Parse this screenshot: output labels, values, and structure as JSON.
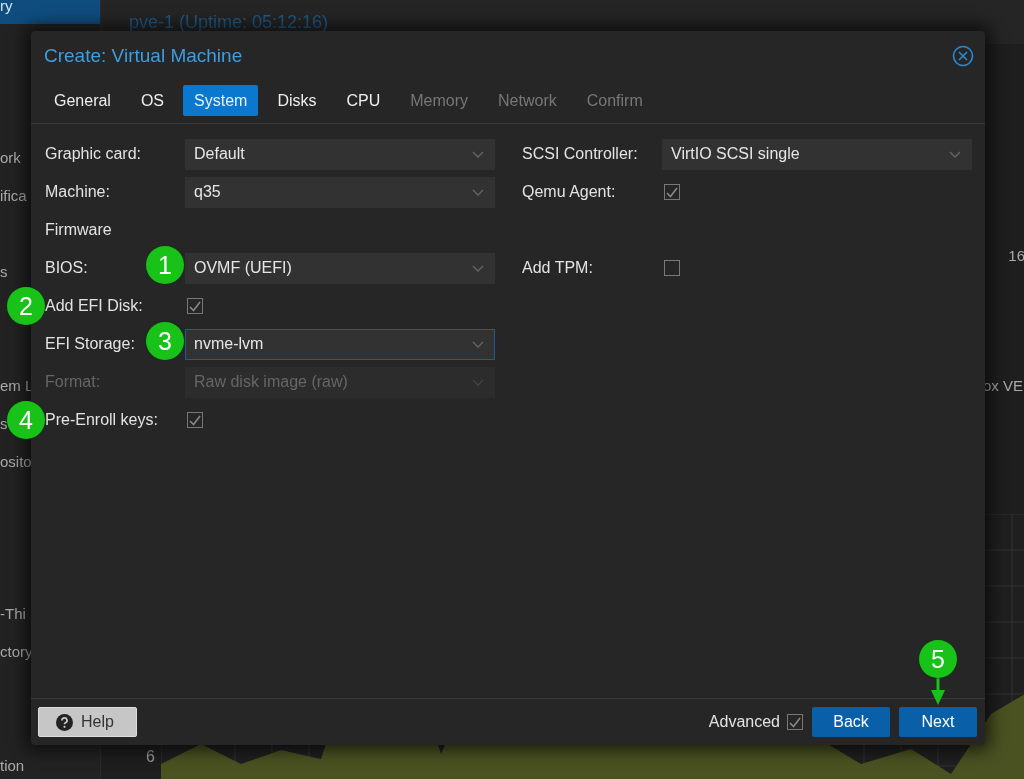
{
  "background": {
    "sidebar": [
      {
        "label": "ry",
        "selected": true
      },
      {
        "label": "ork",
        "selected": false
      },
      {
        "label": "ifica",
        "selected": false
      },
      {
        "label": "s",
        "selected": false
      },
      {
        "label": "em L",
        "selected": false
      },
      {
        "label": "s",
        "selected": false
      },
      {
        "label": "osito",
        "selected": false
      },
      {
        "label": "-Thi",
        "selected": false
      },
      {
        "label": "ctory",
        "selected": false
      },
      {
        "label": "tion",
        "selected": false
      }
    ],
    "header": "pve-1 (Uptime: 05:12:16)",
    "side_texts": [
      "16",
      "ox VE"
    ],
    "chart_tick": "6"
  },
  "dialog": {
    "title": "Create: Virtual Machine",
    "tabs": [
      {
        "label": "General",
        "selected": false,
        "disabled": false
      },
      {
        "label": "OS",
        "selected": false,
        "disabled": false
      },
      {
        "label": "System",
        "selected": true,
        "disabled": false
      },
      {
        "label": "Disks",
        "selected": false,
        "disabled": false
      },
      {
        "label": "CPU",
        "selected": false,
        "disabled": false
      },
      {
        "label": "Memory",
        "selected": false,
        "disabled": true
      },
      {
        "label": "Network",
        "selected": false,
        "disabled": true
      },
      {
        "label": "Confirm",
        "selected": false,
        "disabled": true
      }
    ],
    "rows": [
      {
        "left": {
          "kind": "combo",
          "label": "Graphic card:",
          "value": "Default",
          "disabled": false,
          "focused": false
        },
        "right": {
          "kind": "combo",
          "label": "SCSI Controller:",
          "value": "VirtIO SCSI single",
          "disabled": false,
          "focused": false
        }
      },
      {
        "left": {
          "kind": "combo",
          "label": "Machine:",
          "value": "q35",
          "disabled": false,
          "focused": false
        },
        "right": {
          "kind": "checkbox",
          "label": "Qemu Agent:",
          "checked": true
        }
      },
      {
        "left": {
          "kind": "section",
          "label": "Firmware"
        }
      },
      {
        "left": {
          "kind": "combo",
          "label": "BIOS:",
          "value": "OVMF (UEFI)",
          "disabled": false,
          "focused": false,
          "marker": "1"
        },
        "right": {
          "kind": "checkbox",
          "label": "Add TPM:",
          "checked": false
        }
      },
      {
        "left": {
          "kind": "checkbox",
          "label": "Add EFI Disk:",
          "checked": true,
          "marker": "2"
        }
      },
      {
        "left": {
          "kind": "combo",
          "label": "EFI Storage:",
          "value": "nvme-lvm",
          "disabled": false,
          "focused": true,
          "marker": "3"
        }
      },
      {
        "left": {
          "kind": "combo",
          "label": "Format:",
          "value": "Raw disk image (raw)",
          "disabled": true,
          "focused": false
        }
      },
      {
        "left": {
          "kind": "checkbox",
          "label": "Pre-Enroll keys:",
          "checked": true,
          "marker": "4"
        }
      }
    ],
    "footer": {
      "help": "Help",
      "advanced": {
        "label": "Advanced",
        "checked": true
      },
      "buttons": [
        {
          "label": "Back"
        },
        {
          "label": "Next",
          "marker": "5"
        }
      ]
    }
  }
}
